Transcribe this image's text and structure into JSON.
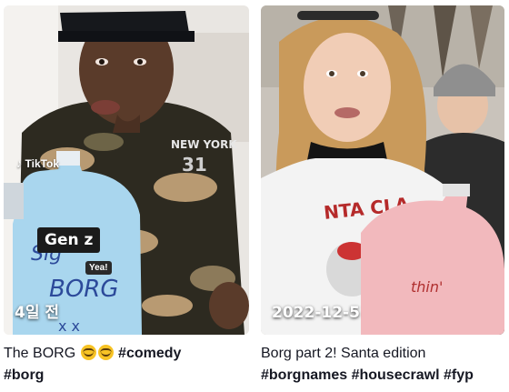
{
  "videos": [
    {
      "date": "4일 전",
      "watermark": "TikTok",
      "shirt_text": "NEW YORK",
      "jug_text": "Sign BORG",
      "overlay_label": "Gen z",
      "overlay_sublabel": "Yea!",
      "caption_text": "The BORG",
      "caption_emojis": [
        "grinning-face-with-sweat-icon",
        "grinning-face-with-sweat-icon"
      ],
      "caption_tag_inline": "#comedy",
      "caption_tags": "#borg"
    },
    {
      "date": "2022-12-5",
      "shirt_text": "NTA CLA",
      "caption_text": "Borg part 2! Santa edition",
      "caption_tags": "#borgnames #housecrawl #fyp"
    }
  ],
  "colors": {
    "caption_text": "#161823",
    "jug_blue": "#a9d6ee",
    "jug_pink": "#f2b9bd",
    "camo_dark": "#2d2a20",
    "camo_tan": "#b89a72"
  }
}
